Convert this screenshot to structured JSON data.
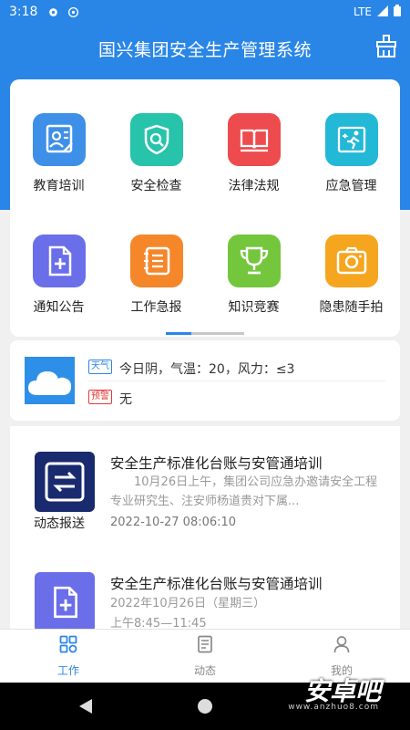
{
  "status_bar": {
    "time": "3:18",
    "network": "LTE"
  },
  "app_bar": {
    "title": "国兴集团安全生产管理系统"
  },
  "grid": {
    "items": [
      {
        "label": "教育培训",
        "color": "#3d8fe8",
        "icon": "education-icon"
      },
      {
        "label": "安全检查",
        "color": "#27c3aa",
        "icon": "shield-search-icon"
      },
      {
        "label": "法律法规",
        "color": "#ee4b4e",
        "icon": "book-icon"
      },
      {
        "label": "应急管理",
        "color": "#22b8d6",
        "icon": "emergency-exit-icon"
      },
      {
        "label": "通知公告",
        "color": "#6a6ee8",
        "icon": "document-plus-icon"
      },
      {
        "label": "工作急报",
        "color": "#f5872a",
        "icon": "notepad-icon"
      },
      {
        "label": "知识竞赛",
        "color": "#74c63c",
        "icon": "trophy-icon"
      },
      {
        "label": "隐患随手拍",
        "color": "#f6a51e",
        "icon": "camera-icon"
      }
    ]
  },
  "weather": {
    "weather_tag": "天气",
    "weather_text": "今日阴，气温：20，风力：≤3",
    "alert_tag": "预警",
    "alert_text": "无"
  },
  "news": [
    {
      "title": "安全生产标准化台账与安管通培训",
      "summary": "　　10月26日上午，集团公司应急办邀请安全工程专业研究生、注安师杨道贵对下属...",
      "date": "2022-10-27 08:06:10",
      "image_caption": "动态报送"
    },
    {
      "title": "安全生产标准化台账与安管通培训",
      "summary_line1": "2022年10月26日（星期三）",
      "summary_line2": "上午8:45—11:45"
    }
  ],
  "tabs": [
    {
      "label": "工作",
      "active": true
    },
    {
      "label": "动态",
      "active": false
    },
    {
      "label": "我的",
      "active": false
    }
  ],
  "watermark": {
    "text": "安卓吧",
    "sub": "www.anzhuo8.com"
  },
  "colors": {
    "primary": "#2a86e6",
    "tab_active": "#2a86e6",
    "tab_inactive": "#888888"
  }
}
